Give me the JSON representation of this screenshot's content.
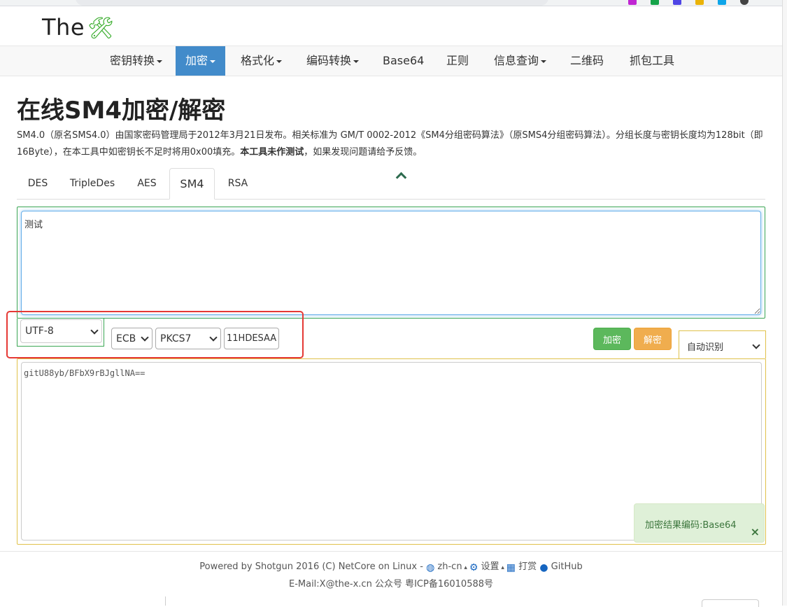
{
  "header": {
    "logo_text": "The",
    "logo_icon": "tools-icon"
  },
  "nav": {
    "items": [
      {
        "label": "密钥转换",
        "dropdown": true
      },
      {
        "label": "加密",
        "dropdown": true,
        "active": true
      },
      {
        "label": "格式化",
        "dropdown": true
      },
      {
        "label": "编码转换",
        "dropdown": true
      },
      {
        "label": "Base64",
        "dropdown": false
      },
      {
        "label": "正则",
        "dropdown": false
      },
      {
        "label": "信息查询",
        "dropdown": true
      },
      {
        "label": "二维码",
        "dropdown": false
      },
      {
        "label": "抓包工具",
        "dropdown": false
      }
    ]
  },
  "page": {
    "title": "在线SM4加密/解密",
    "desc_part1": "SM4.0（原名SMS4.0）由国家密码管理局于2012年3月21日发布。相关标准为 GM/T 0002-2012《SM4分组密码算法》（原SMS4分组密码算法）。分组长度与密钥长度均为128bit（即16Byte），在本工具中如密钥长不足时将用0x00填充。",
    "desc_bold": "本工具未作测试",
    "desc_part2": "，如果发现问题请给予反馈。"
  },
  "tabs": [
    "DES",
    "TripleDes",
    "AES",
    "SM4",
    "RSA"
  ],
  "active_tab": "SM4",
  "input": {
    "value": "测试"
  },
  "controls": {
    "encoding": "UTF-8",
    "mode": "ECB",
    "padding": "PKCS7",
    "key": "11HDESAA",
    "encrypt_label": "加密",
    "decrypt_label": "解密",
    "output_format": "自动识别"
  },
  "output": {
    "value": "gitU88yb/BFbX9rBJgllNA=="
  },
  "toast": {
    "message": "加密结果编码:Base64",
    "close": "×"
  },
  "footer": {
    "powered": "Powered by Shotgun 2016 (C) NetCore on Linux -",
    "lang": "zh-cn",
    "settings": "设置",
    "reward": "打赏",
    "github": "GitHub",
    "contact": "E-Mail:X@the-x.cn 公众号 粤ICP备16010588号"
  },
  "colors": {
    "nav_active": "#428bca",
    "input_border": "#3aa653",
    "output_border": "#e0c14a",
    "highlight": "#e53935",
    "encrypt_btn": "#5cb85c",
    "decrypt_btn": "#f0ad4e"
  }
}
